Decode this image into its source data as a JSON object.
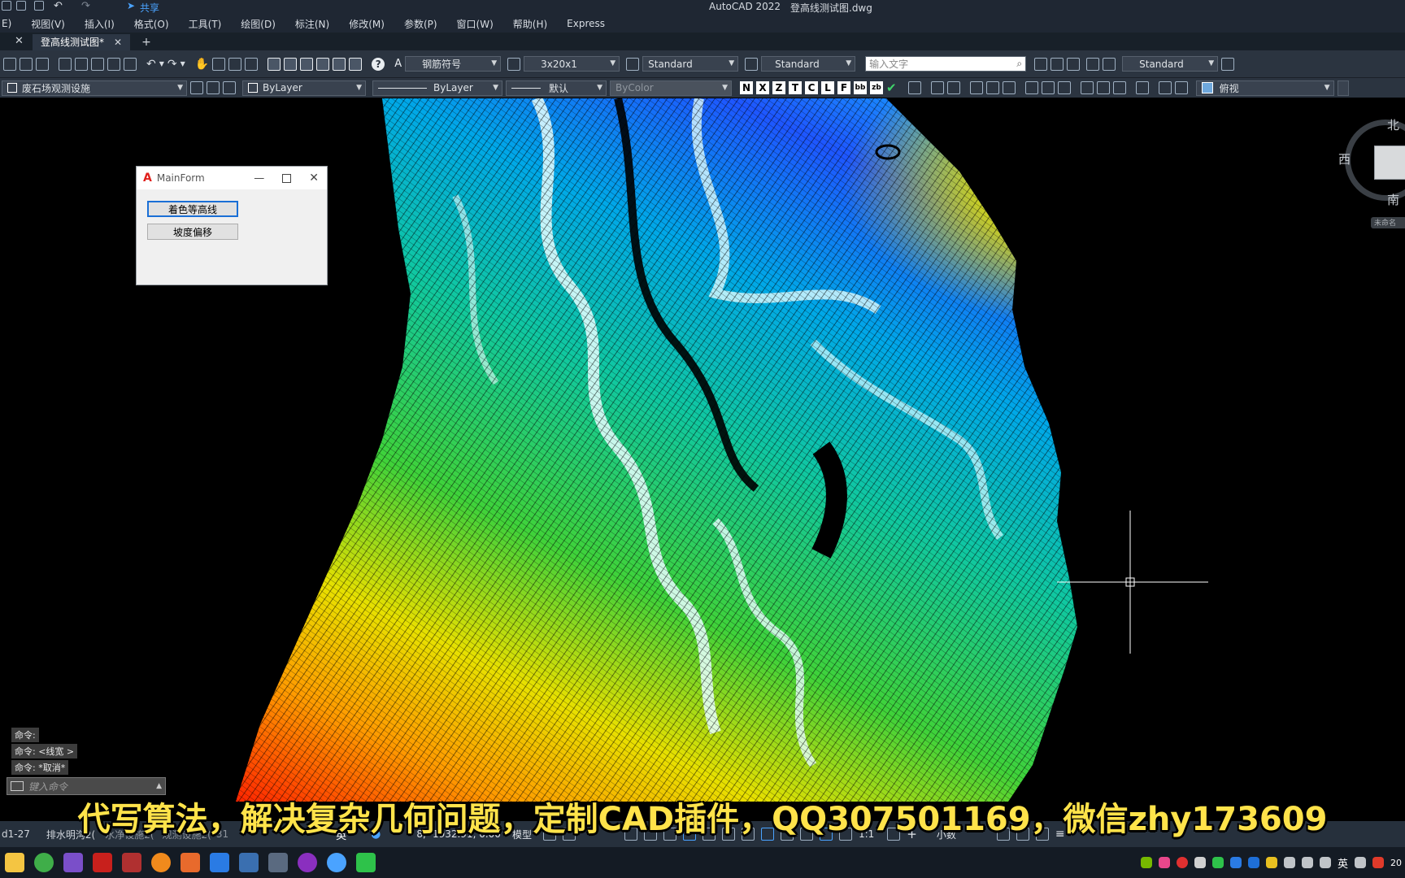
{
  "app": {
    "title": "AutoCAD 2022",
    "filename": "登高线测试图.dwg",
    "share_label": "共享"
  },
  "menu": [
    "E)",
    "视图(V)",
    "插入(I)",
    "格式(O)",
    "工具(T)",
    "绘图(D)",
    "标注(N)",
    "修改(M)",
    "参数(P)",
    "窗口(W)",
    "帮助(H)",
    "Express"
  ],
  "tabs": [
    {
      "label": "登高线测试图*"
    }
  ],
  "toolbar1": {
    "text_style": "钢筋符号",
    "dim_value": "3x20x1",
    "style1": "Standard",
    "style2": "Standard",
    "search_placeholder": "输入文字",
    "style3": "Standard"
  },
  "toolbar2": {
    "layer": "废石场观测设施",
    "color": "ByLayer",
    "linetype": "ByLayer",
    "lineweight": "默认",
    "plotstyle": "ByColor",
    "letters": [
      "N",
      "X",
      "Z",
      "T",
      "C",
      "L",
      "F",
      "bb",
      "zb"
    ],
    "view": "俯视"
  },
  "viewcube": {
    "north": "北",
    "west": "西",
    "south": "南",
    "unnamed": "未命名"
  },
  "mainform": {
    "title": "MainForm",
    "button1": "着色等高线",
    "button2": "坡度偏移"
  },
  "command": {
    "history": [
      "命令:",
      "命令: <线宽 >",
      "命令: *取消*"
    ],
    "placeholder": "键入命令"
  },
  "status": {
    "tabs": [
      "d1-27",
      "排水明沟2(",
      "水净设施2(",
      "观测设施2(",
      "31"
    ],
    "ime": "英",
    "coords": "8, -1932.91, 0.00",
    "model": "模型",
    "scale": "1:1",
    "units": "小数"
  },
  "taskbar": {
    "ime": "英",
    "clock": "20"
  },
  "subtitle": "代写算法，解决复杂几何问题，定制CAD插件，QQ307501169，微信zhy173609",
  "colors": {
    "chrome": "#1f2733",
    "toolbar": "#2b3440",
    "canvas": "#000000",
    "subtitle": "#ffe34a"
  }
}
